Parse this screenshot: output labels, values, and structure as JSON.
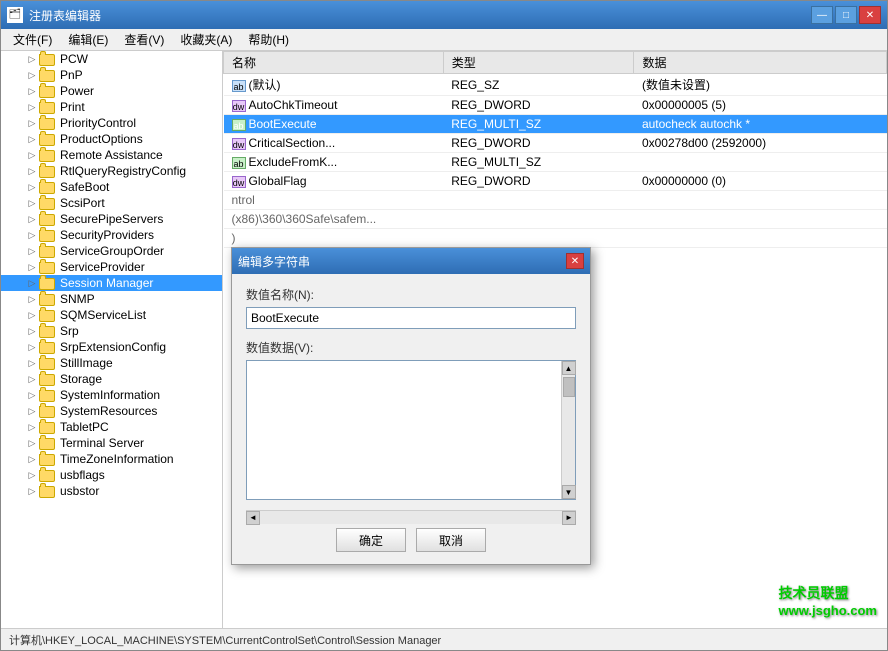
{
  "window": {
    "title": "注册表编辑器",
    "title_icon": "🗂"
  },
  "titlebar_buttons": {
    "minimize": "—",
    "maximize": "□",
    "close": "✕"
  },
  "menu": {
    "items": [
      "文件(F)",
      "编辑(E)",
      "查看(V)",
      "收藏夹(A)",
      "帮助(H)"
    ]
  },
  "tree": {
    "items": [
      {
        "label": "PCW",
        "indent": 1,
        "selected": false
      },
      {
        "label": "PnP",
        "indent": 1,
        "selected": false
      },
      {
        "label": "Power",
        "indent": 1,
        "selected": false
      },
      {
        "label": "Print",
        "indent": 1,
        "selected": false
      },
      {
        "label": "PriorityControl",
        "indent": 1,
        "selected": false
      },
      {
        "label": "ProductOptions",
        "indent": 1,
        "selected": false
      },
      {
        "label": "Remote Assistance",
        "indent": 1,
        "selected": false
      },
      {
        "label": "RtlQueryRegistryConfig",
        "indent": 1,
        "selected": false
      },
      {
        "label": "SafeBoot",
        "indent": 1,
        "selected": false
      },
      {
        "label": "ScsiPort",
        "indent": 1,
        "selected": false
      },
      {
        "label": "SecurePipeServers",
        "indent": 1,
        "selected": false
      },
      {
        "label": "SecurityProviders",
        "indent": 1,
        "selected": false
      },
      {
        "label": "ServiceGroupOrder",
        "indent": 1,
        "selected": false
      },
      {
        "label": "ServiceProvider",
        "indent": 1,
        "selected": false
      },
      {
        "label": "Session Manager",
        "indent": 1,
        "selected": true
      },
      {
        "label": "SNMP",
        "indent": 1,
        "selected": false
      },
      {
        "label": "SQMServiceList",
        "indent": 1,
        "selected": false
      },
      {
        "label": "Srp",
        "indent": 1,
        "selected": false
      },
      {
        "label": "SrpExtensionConfig",
        "indent": 1,
        "selected": false
      },
      {
        "label": "StillImage",
        "indent": 1,
        "selected": false
      },
      {
        "label": "Storage",
        "indent": 1,
        "selected": false
      },
      {
        "label": "SystemInformation",
        "indent": 1,
        "selected": false
      },
      {
        "label": "SystemResources",
        "indent": 1,
        "selected": false
      },
      {
        "label": "TabletPC",
        "indent": 1,
        "selected": false
      },
      {
        "label": "Terminal Server",
        "indent": 1,
        "selected": false
      },
      {
        "label": "TimeZoneInformation",
        "indent": 1,
        "selected": false
      },
      {
        "label": "usbflags",
        "indent": 1,
        "selected": false
      },
      {
        "label": "usbstor",
        "indent": 1,
        "selected": false
      }
    ]
  },
  "table": {
    "columns": [
      "名称",
      "类型",
      "数据"
    ],
    "rows": [
      {
        "name": "(默认)",
        "type": "REG_SZ",
        "data": "(数值未设置)",
        "icon": "sz",
        "icon_text": "ab"
      },
      {
        "name": "AutoChkTimeout",
        "type": "REG_DWORD",
        "data": "0x00000005 (5)",
        "icon": "dword",
        "icon_text": "dw"
      },
      {
        "name": "BootExecute",
        "type": "REG_MULTI_SZ",
        "data": "autocheck autochk *",
        "icon": "multi",
        "icon_text": "ab",
        "selected": true
      },
      {
        "name": "CriticalSection...",
        "type": "REG_DWORD",
        "data": "0x00278d00 (2592000)",
        "icon": "dword",
        "icon_text": "dw"
      },
      {
        "name": "ExcludeFromK...",
        "type": "REG_MULTI_SZ",
        "data": "",
        "icon": "multi",
        "icon_text": "ab"
      },
      {
        "name": "GlobalFlag",
        "type": "REG_DWORD",
        "data": "0x00000000 (0)",
        "icon": "dword",
        "icon_text": "dw"
      }
    ],
    "partial_rows": [
      {
        "text": "ntrol",
        "indent": true
      },
      {
        "text": "(x86)\\360\\360Safe\\safem...",
        "indent": true
      },
      {
        "text": ")",
        "indent": true
      }
    ]
  },
  "dialog": {
    "title": "编辑多字符串",
    "name_label": "数值名称(N):",
    "name_value": "BootExecute",
    "data_label": "数值数据(V):",
    "data_value": "",
    "ok_button": "确定",
    "cancel_button": "取消"
  },
  "status_bar": {
    "text": "计算机\\HKEY_LOCAL_MACHINE\\SYSTEM\\CurrentControlSet\\Control\\Session Manager"
  },
  "watermark": {
    "line1": "技术员联盟",
    "line2": "www.jsgho.com"
  }
}
